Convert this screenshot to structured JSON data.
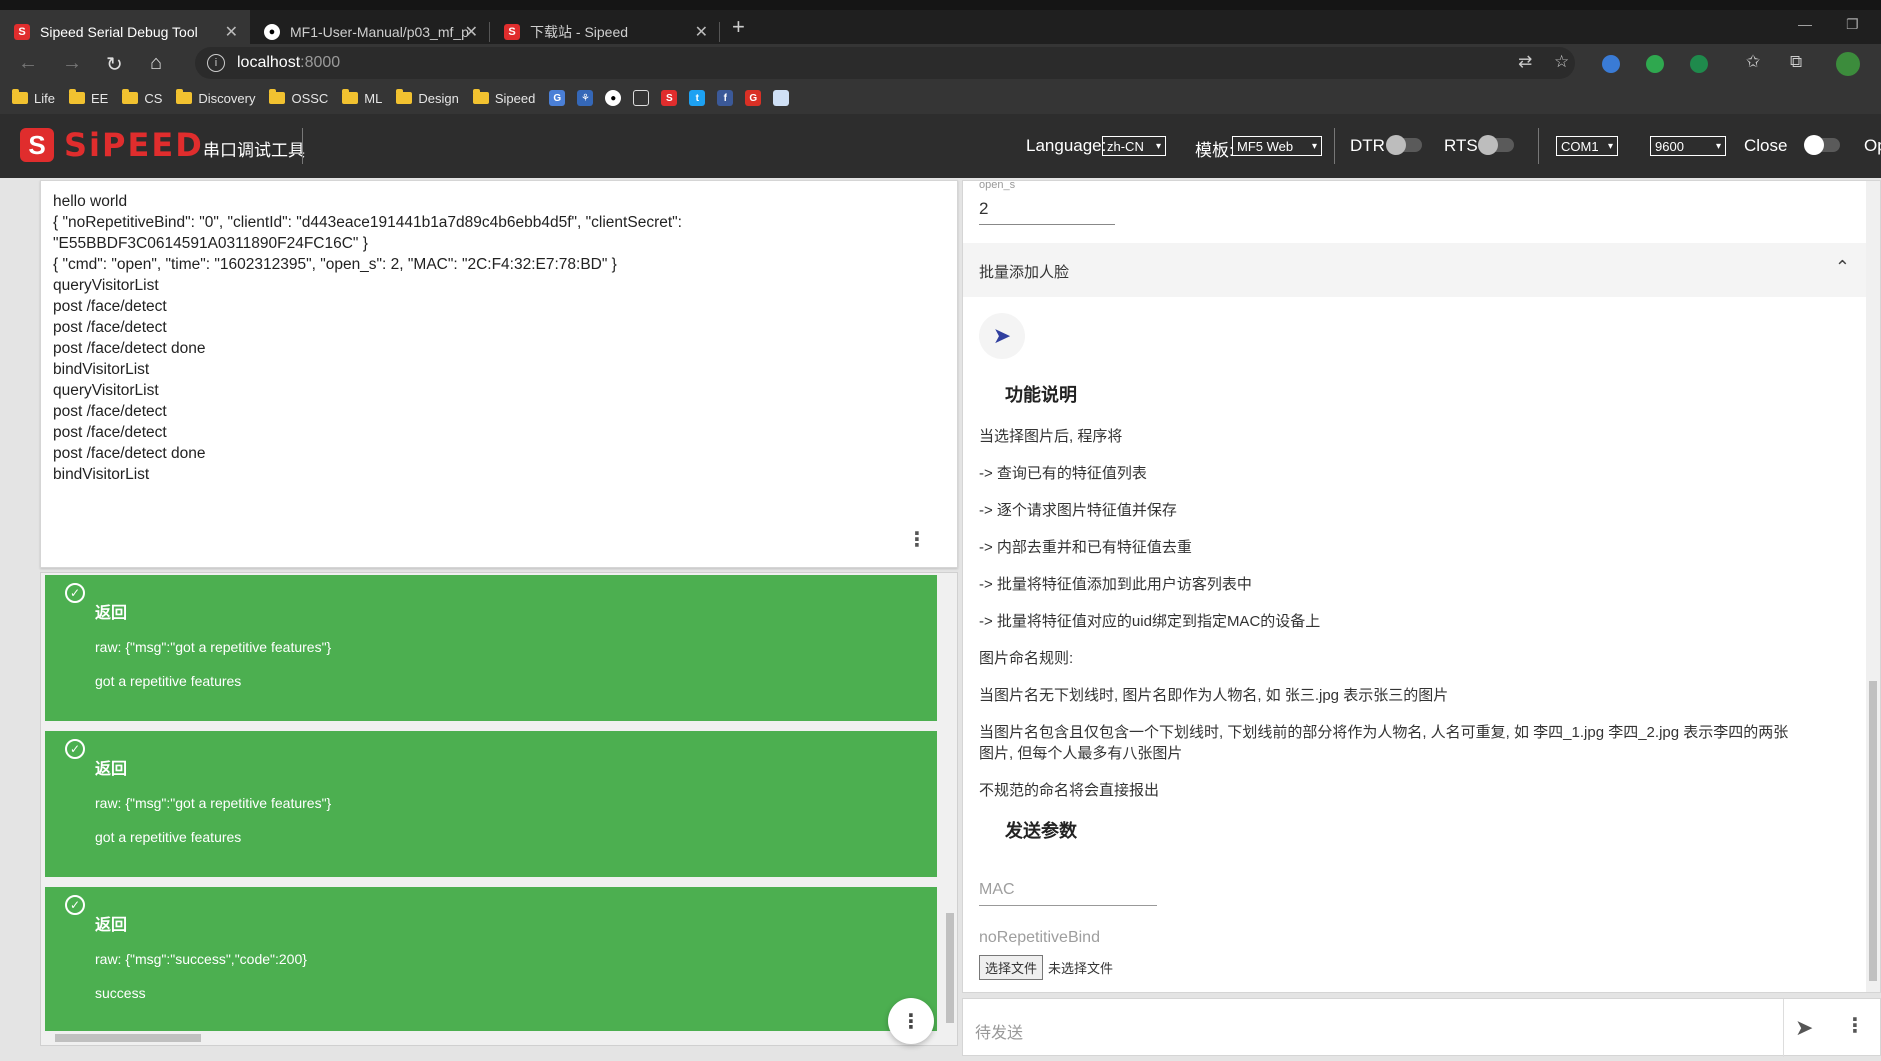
{
  "browser": {
    "tabs": [
      {
        "title": "Sipeed Serial Debug Tool",
        "favicon": "S"
      },
      {
        "title": "MF1-User-Manual/p03_mf_proto",
        "favicon": "github"
      },
      {
        "title": "下载站 - Sipeed",
        "favicon": "S"
      }
    ],
    "url_host": "localhost",
    "url_port": ":8000",
    "bookmarks": [
      "Life",
      "EE",
      "CS",
      "Discovery",
      "OSSC",
      "ML",
      "Design",
      "Sipeed"
    ]
  },
  "app": {
    "logo_letter": "S",
    "logo_text": "SiPEED",
    "title": "串口调试工具",
    "language_label": "Language:",
    "language_value": "zh-CN",
    "template_label": "模板:",
    "template_value": "MF5 Web",
    "dtr_label": "DTR",
    "rts_label": "RTS",
    "port_value": "COM1",
    "baud_value": "9600",
    "close_label": "Close",
    "open_label": "Op"
  },
  "log": {
    "lines": [
      "hello world",
      "{ \"noRepetitiveBind\": \"0\", \"clientId\": \"d443eace191441b1a7d89c4b6ebb4d5f\", \"clientSecret\":",
      "\"E55BBDF3C0614591A0311890F24FC16C\" }",
      "{ \"cmd\": \"open\", \"time\": \"1602312395\", \"open_s\": 2, \"MAC\": \"2C:F4:32:E7:78:BD\" }",
      "queryVisitorList",
      "post /face/detect",
      "post /face/detect",
      "post /face/detect done",
      "bindVisitorList",
      "queryVisitorList",
      "post /face/detect",
      "post /face/detect",
      "post /face/detect done",
      "bindVisitorList"
    ]
  },
  "responses": [
    {
      "title": "返回",
      "raw": "raw: {\"msg\":\"got a repetitive features\"}",
      "msg": "got a repetitive features"
    },
    {
      "title": "返回",
      "raw": "raw: {\"msg\":\"got a repetitive features\"}",
      "msg": "got a repetitive features"
    },
    {
      "title": "返回",
      "raw": "raw: {\"msg\":\"success\",\"code\":200}",
      "msg": "success"
    }
  ],
  "panel": {
    "open_s_label": "open_s",
    "open_s_value": "2",
    "section_title": "批量添加人脸",
    "func_title": "功能说明",
    "desc_lines": [
      "当选择图片后, 程序将",
      "-> 查询已有的特征值列表",
      "-> 逐个请求图片特征值并保存",
      "-> 内部去重并和已有特征值去重",
      "-> 批量将特征值添加到此用户访客列表中",
      "-> 批量将特征值对应的uid绑定到指定MAC的设备上",
      "图片命名规则:",
      "当图片名无下划线时, 图片名即作为人物名, 如 张三.jpg 表示张三的图片",
      "当图片名包含且仅包含一个下划线时, 下划线前的部分将作为人物名, 人名可重复, 如 李四_1.jpg 李四_2.jpg 表示李四的两张",
      "图片, 但每个人最多有八张图片",
      "不规范的命名将会直接报出"
    ],
    "params_title": "发送参数",
    "mac_placeholder": "MAC",
    "norep_placeholder": "noRepetitiveBind",
    "file_button": "选择文件",
    "file_status": "未选择文件"
  },
  "sendbar": {
    "placeholder": "待发送"
  }
}
